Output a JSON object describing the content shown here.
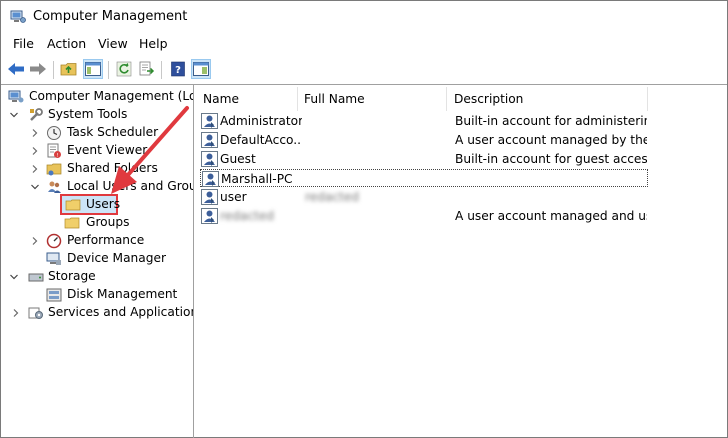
{
  "window": {
    "title": "Computer Management"
  },
  "menu": [
    "File",
    "Action",
    "View",
    "Help"
  ],
  "tree": {
    "root": "Computer Management (Local",
    "system_tools": "System Tools",
    "task_scheduler": "Task Scheduler",
    "event_viewer": "Event Viewer",
    "shared_folders": "Shared Folders",
    "local_users_groups": "Local Users and Groups",
    "users": "Users",
    "groups": "Groups",
    "performance": "Performance",
    "device_manager": "Device Manager",
    "storage": "Storage",
    "disk_management": "Disk Management",
    "services_apps": "Services and Applications"
  },
  "list": {
    "columns": {
      "name": "Name",
      "full_name": "Full Name",
      "description": "Description"
    },
    "rows": [
      {
        "name": "Administrator",
        "full_name": "",
        "description": "Built-in account for administering..."
      },
      {
        "name": "DefaultAcco...",
        "full_name": "",
        "description": "A user account managed by the s..."
      },
      {
        "name": "Guest",
        "full_name": "",
        "description": "Built-in account for guest access t..."
      },
      {
        "name": "Marshall-PC",
        "full_name": "",
        "description": ""
      },
      {
        "name": "user",
        "full_name": "redacted",
        "description": ""
      },
      {
        "name": "redacted",
        "full_name": "",
        "description": "A user account managed and use..."
      }
    ]
  },
  "colors": {
    "highlight_border": "#e0393e",
    "arrow": "#e0393e",
    "selection": "#cce4f7"
  }
}
